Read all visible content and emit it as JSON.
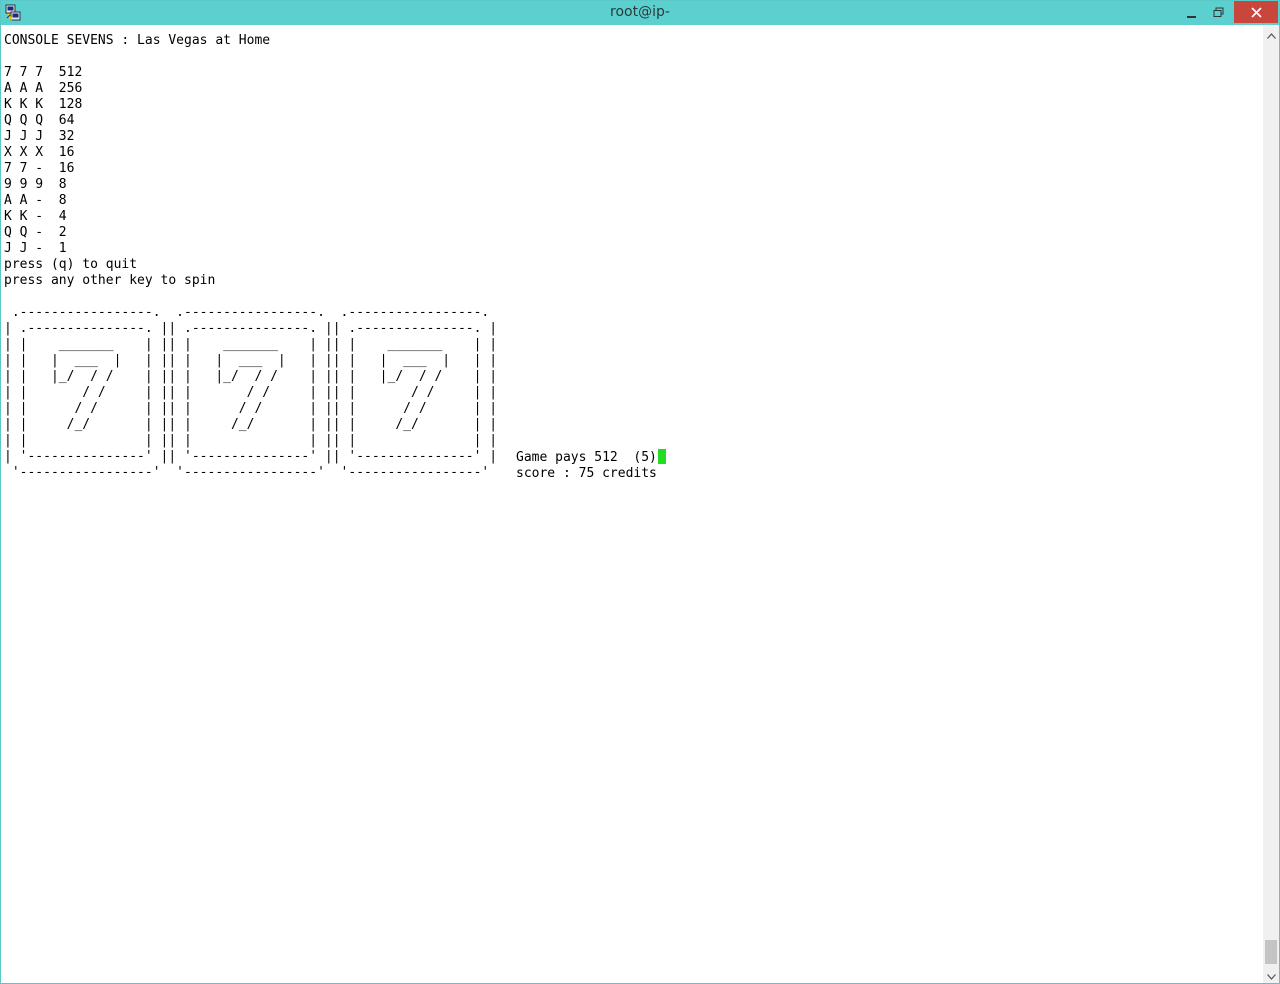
{
  "window": {
    "title": "root@ip-",
    "colors": {
      "titlebar": "#5ccfcf",
      "close_button": "#c9463d",
      "cursor": "#22dd22"
    },
    "icons": {
      "app": "putty-icon",
      "minimize": "minimize-icon",
      "maximize": "restore-icon",
      "close": "close-icon"
    }
  },
  "terminal": {
    "header": "CONSOLE SEVENS : Las Vegas at Home",
    "paytable": [
      "7 7 7  512",
      "A A A  256",
      "K K K  128",
      "Q Q Q  64",
      "J J J  32",
      "X X X  16",
      "7 7 -  16",
      "9 9 9  8",
      "A A -  8",
      "K K -  4",
      "Q Q -  2",
      "J J -  1"
    ],
    "quit_hint": "press (q) to quit",
    "spin_hint": "press any other key to spin",
    "slot_art": [
      " .-----------------.  .-----------------.  .-----------------.",
      "| .---------------. || .---------------. || .---------------. |",
      "| |    _______    | || |    _______    | || |    _______    | |",
      "| |   |  ___  |   | || |   |  ___  |   | || |   |  ___  |   | |",
      "| |   |_/  / /    | || |   |_/  / /    | || |   |_/  / /    | |",
      "| |       / /     | || |       / /     | || |       / /     | |",
      "| |      / /      | || |      / /      | || |      / /      | |",
      "| |     /_/       | || |     /_/       | || |     /_/       | |",
      "| |               | || |               | || |               | |",
      "| '---------------' || '---------------' || '---------------' |",
      " '-----------------'  '-----------------'  '-----------------'"
    ],
    "payout_text": "Game pays 512  (5)",
    "score_text": "score : 75 credits"
  }
}
